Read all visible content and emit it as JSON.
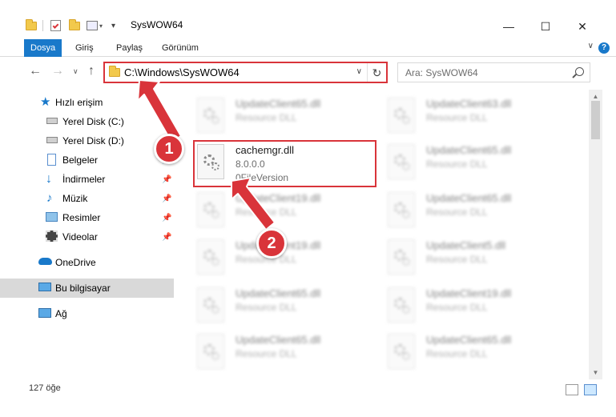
{
  "window": {
    "title": "SysWOW64",
    "minimize": "—",
    "maximize": "☐",
    "close": "✕"
  },
  "ribbon": {
    "tabs": [
      "Dosya",
      "Giriş",
      "Paylaş",
      "Görünüm"
    ],
    "help": "?",
    "collapse": "∨"
  },
  "nav": {
    "back": "←",
    "forward": "→",
    "recent": "∨",
    "up": "↑"
  },
  "address": {
    "path": "C:\\Windows\\SysWOW64",
    "dropdown": "∨",
    "refresh": "↻"
  },
  "search": {
    "placeholder": "Ara: SysWOW64"
  },
  "sidebar": {
    "items": [
      {
        "label": "Hızlı erişim",
        "icon": "star-icon",
        "pinned": false
      },
      {
        "label": "Yerel Disk (C:)",
        "icon": "drive-icon",
        "pinned": true
      },
      {
        "label": "Yerel Disk (D:)",
        "icon": "drive-icon",
        "pinned": true
      },
      {
        "label": "Belgeler",
        "icon": "document-icon",
        "pinned": true
      },
      {
        "label": "İndirmeler",
        "icon": "download-icon",
        "pinned": true
      },
      {
        "label": "Müzik",
        "icon": "music-icon",
        "pinned": true
      },
      {
        "label": "Resimler",
        "icon": "pictures-icon",
        "pinned": true
      },
      {
        "label": "Videolar",
        "icon": "video-icon",
        "pinned": true
      },
      {
        "label": "OneDrive",
        "icon": "cloud-icon",
        "pinned": false
      },
      {
        "label": "Bu bilgisayar",
        "icon": "computer-icon",
        "pinned": false,
        "selected": true
      },
      {
        "label": "Ağ",
        "icon": "network-icon",
        "pinned": false
      }
    ]
  },
  "files": {
    "left": [
      {
        "name": "UpdateClient65.dll",
        "type": "Resource DLL"
      },
      {
        "name": "cachemgr.dll",
        "version": "8.0.0.0",
        "extra": "0FileVersion"
      },
      {
        "name": "UpdateClient19.dll",
        "type": "Resource DLL"
      },
      {
        "name": "UpdateClient19.dll",
        "type": "Resource DLL"
      },
      {
        "name": "UpdateClient65.dll",
        "type": "Resource DLL"
      },
      {
        "name": "UpdateClient65.dll",
        "type": "Resource DLL"
      }
    ],
    "right": [
      {
        "name": "UpdateClient63.dll",
        "type": "Resource DLL"
      },
      {
        "name": "UpdateClient65.dll",
        "type": "Resource DLL"
      },
      {
        "name": "UpdateClient65.dll",
        "type": "Resource DLL"
      },
      {
        "name": "UpdateClient5.dll",
        "type": "Resource DLL"
      },
      {
        "name": "UpdateClient19.dll",
        "type": "Resource DLL"
      },
      {
        "name": "UpdateClient65.dll",
        "type": "Resource DLL"
      }
    ]
  },
  "status": {
    "count": "127 öğe"
  },
  "callouts": [
    "1",
    "2"
  ],
  "colors": {
    "accent": "#1979ca",
    "highlight": "#d9343a"
  }
}
